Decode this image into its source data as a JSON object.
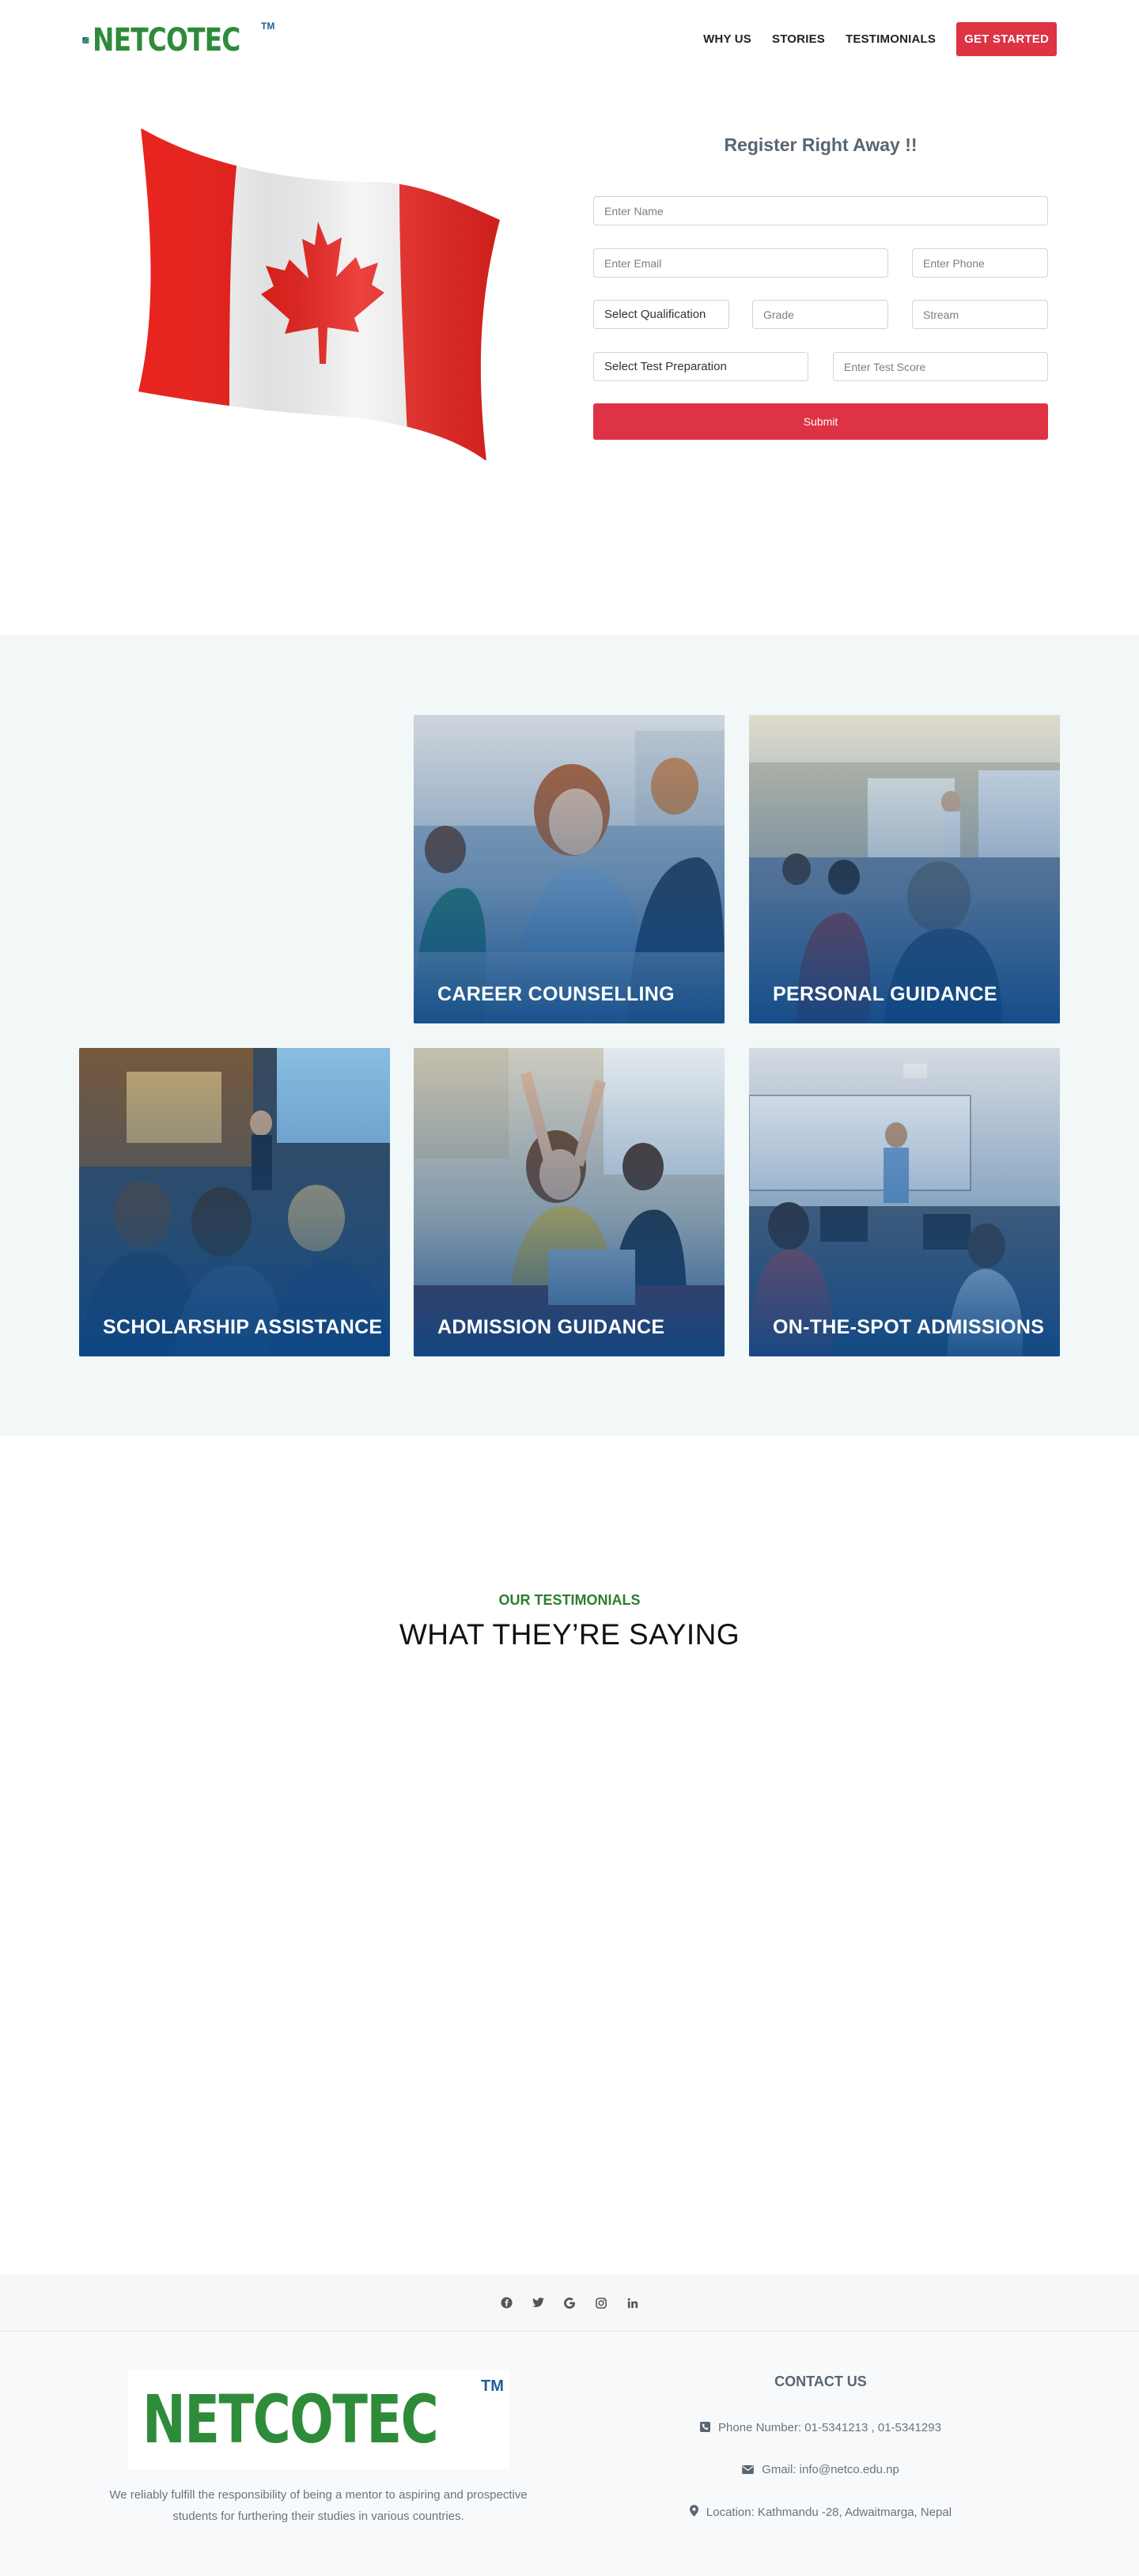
{
  "brand": {
    "name": "NETCOTEC",
    "tm": "TM"
  },
  "nav": {
    "items": [
      "WHY US",
      "STORIES",
      "TESTIMONIALS"
    ],
    "cta": "GET STARTED"
  },
  "register": {
    "title": "Register Right Away !!",
    "name_placeholder": "Enter Name",
    "email_placeholder": "Enter Email",
    "phone_placeholder": "Enter Phone",
    "qualification_selected": "Select Qualification",
    "grade_placeholder": "Grade",
    "stream_placeholder": "Stream",
    "test_prep_selected": "Select Test Preparation",
    "score_placeholder": "Enter Test Score",
    "submit": "Submit"
  },
  "services": [
    {
      "label": "CAREER COUNSELLING"
    },
    {
      "label": "PERSONAL GUIDANCE"
    },
    {
      "label": "SCHOLARSHIP ASSISTANCE"
    },
    {
      "label": "ADMISSION GUIDANCE"
    },
    {
      "label": "ON-THE-SPOT ADMISSIONS"
    }
  ],
  "testimonials": {
    "kicker": "OUR TESTIMONIALS",
    "title": "WHAT THEY’RE SAYING"
  },
  "social_icons": [
    "facebook-icon",
    "twitter-icon",
    "google-icon",
    "instagram-icon",
    "linkedin-icon"
  ],
  "footer": {
    "description": "We reliably fulfill the responsibility of being a mentor to aspiring and prospective students for furthering their studies in various countries.",
    "contact_title": "CONTACT US",
    "phone": "Phone Number: 01-5341213 , 01-5341293",
    "email": "Gmail: info@netco.edu.np",
    "location": "Location: Kathmandu -28, Adwaitmarga, Nepal"
  },
  "colors": {
    "accent": "#dd3344",
    "brand_green": "#2e8b3a",
    "brand_blue": "#1f5e9c",
    "card_overlay": "#0c4887"
  }
}
